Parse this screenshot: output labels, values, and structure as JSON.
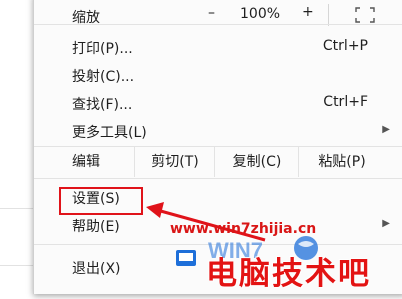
{
  "menu": {
    "zoom": {
      "label": "缩放",
      "minus": "–",
      "value": "100%",
      "plus": "+"
    },
    "print": {
      "label": "打印(P)...",
      "shortcut": "Ctrl+P"
    },
    "cast": {
      "label": "投射(C)..."
    },
    "find": {
      "label": "查找(F)...",
      "shortcut": "Ctrl+F"
    },
    "more_tools": {
      "label": "更多工具(L)"
    },
    "edit": {
      "label": "编辑",
      "cut": "剪切(T)",
      "copy": "复制(C)",
      "paste": "粘贴(P)"
    },
    "settings": {
      "label": "设置(S)"
    },
    "help": {
      "label": "帮助(E)"
    },
    "exit": {
      "label": "退出(X)"
    }
  },
  "watermark": {
    "url": "www.win7zhijia.cn",
    "logo_text": "WIN7",
    "brand": "电脑技术吧"
  },
  "colors": {
    "highlight": "#e0131a",
    "watermark": "#d91616",
    "logo_blue": "#1e6fd9"
  }
}
